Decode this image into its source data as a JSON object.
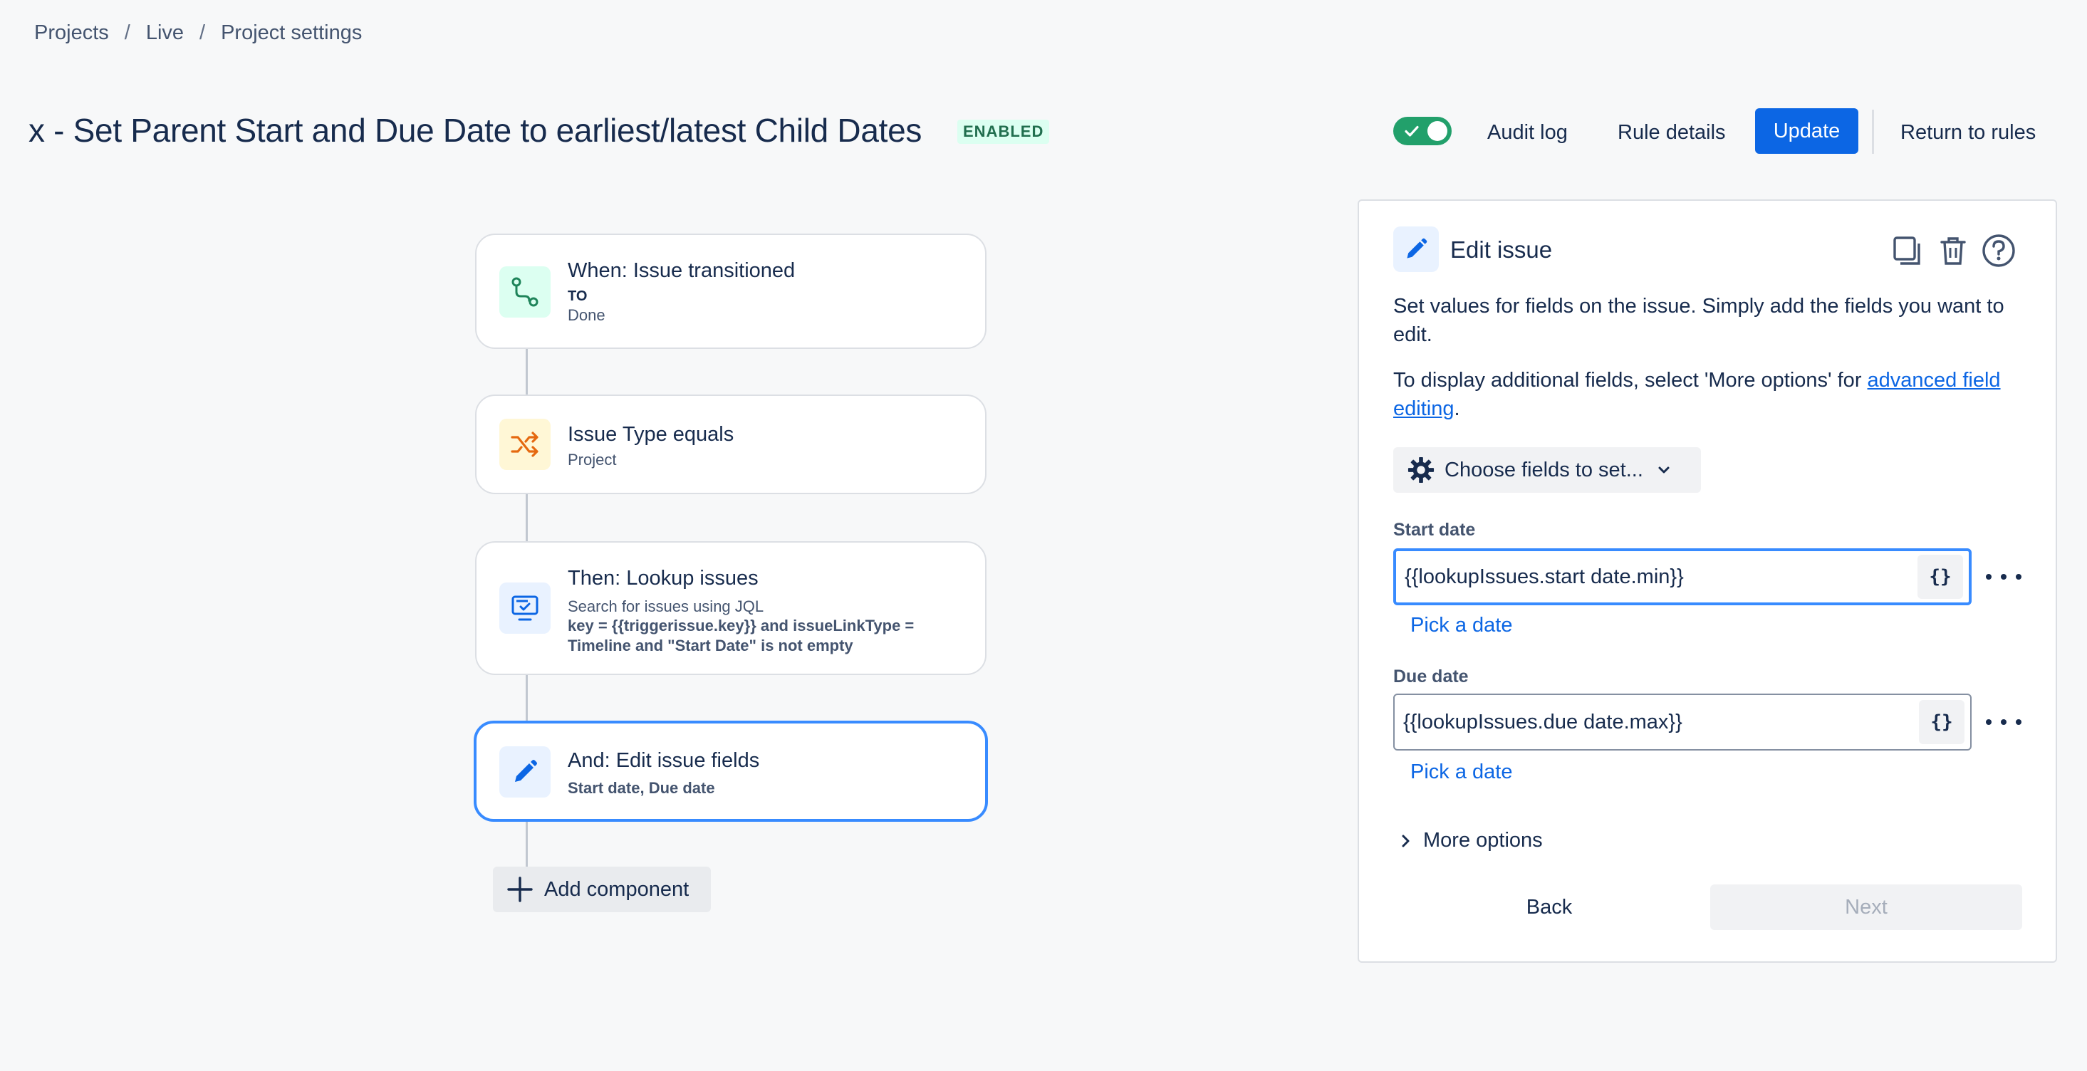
{
  "breadcrumb": [
    "Projects",
    "Live",
    "Project settings"
  ],
  "header": {
    "title": "x - Set Parent Start and Due Date to earliest/latest Child Dates",
    "status": "ENABLED",
    "toggle_on": true,
    "audit_log": "Audit log",
    "rule_details": "Rule details",
    "update": "Update",
    "return_to_rules": "Return to rules"
  },
  "flow": {
    "trigger": {
      "title": "When: Issue transitioned",
      "sub_label": "TO",
      "sub_value": "Done",
      "icon": "transition-icon"
    },
    "condition": {
      "title": "Issue Type equals",
      "sub": "Project",
      "icon": "shuffle-icon"
    },
    "action1": {
      "title": "Then: Lookup issues",
      "sub": "Search for issues using JQL",
      "detail": "key = {{triggerissue.key}} and issueLinkType = Timeline and \"Start Date\" is not empty",
      "icon": "lookup-icon"
    },
    "action2": {
      "title": "And: Edit issue fields",
      "detail": "Start date, Due date",
      "icon": "pencil-icon"
    },
    "add_component": "Add component"
  },
  "panel": {
    "title": "Edit issue",
    "desc1": "Set values for fields on the issue. Simply add the fields you want to edit.",
    "desc2_prefix": "To display additional fields, select 'More options' for ",
    "desc2_link": "advanced field editing",
    "desc2_suffix": ".",
    "choose_fields": "Choose fields to set...",
    "fields": [
      {
        "label": "Start date",
        "value": "{{lookupIssues.start date.min}}",
        "smart": "{}",
        "pick": "Pick a date"
      },
      {
        "label": "Due date",
        "value": "{{lookupIssues.due date.max}}",
        "smart": "{}",
        "pick": "Pick a date"
      }
    ],
    "more_options": "More options",
    "back": "Back",
    "next": "Next"
  },
  "colors": {
    "accent": "#0c66e4",
    "focus": "#388bff",
    "enabled_bg": "#dcfff1",
    "enabled_fg": "#216e4e",
    "toggle": "#22a06b"
  }
}
